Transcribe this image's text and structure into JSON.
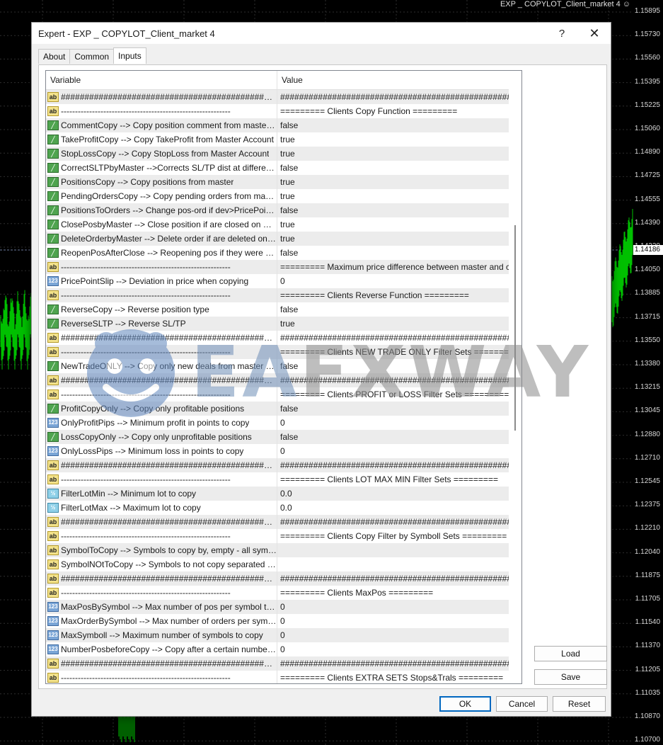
{
  "chart": {
    "title": "EXP _ COPYLOT_Client_market 4 ☺",
    "price_ticks": [
      "1.15895",
      "1.15730",
      "1.15560",
      "1.15395",
      "1.15225",
      "1.15060",
      "1.14890",
      "1.14725",
      "1.14555",
      "1.14390",
      "1.14220",
      "1.14050",
      "1.13885",
      "1.13715",
      "1.13550",
      "1.13380",
      "1.13215",
      "1.13045",
      "1.12880",
      "1.12710",
      "1.12545",
      "1.12375",
      "1.12210",
      "1.12040",
      "1.11875",
      "1.11705",
      "1.11540",
      "1.11370",
      "1.11205",
      "1.11035",
      "1.10870",
      "1.10700"
    ],
    "current_price": "1.14186",
    "candle_color": "#00c000"
  },
  "dialog": {
    "title": "Expert - EXP _ COPYLOT_Client_market 4",
    "help_label": "?",
    "close_label": "✕",
    "tabs": [
      {
        "label": "About",
        "active": false
      },
      {
        "label": "Common",
        "active": false
      },
      {
        "label": "Inputs",
        "active": true
      }
    ],
    "columns": {
      "variable": "Variable",
      "value": "Value"
    },
    "rows": [
      {
        "type": "ab",
        "variable": "###################################################",
        "value": "###################################################"
      },
      {
        "type": "ab",
        "variable": "------------------------------------------------------------",
        "value": "=========  Clients Copy Function  ========="
      },
      {
        "type": "bool",
        "variable": "CommentCopy --> Copy position comment from master position",
        "value": "false"
      },
      {
        "type": "bool",
        "variable": "TakeProfitCopy --> Copy TakeProfit from Master Account",
        "value": "true"
      },
      {
        "type": "bool",
        "variable": "StopLossCopy --> Copy StopLoss from Master Account",
        "value": "true"
      },
      {
        "type": "bool",
        "variable": "CorrectSLTPbyMaster -->Corrects SL/TP dist at different prices",
        "value": "false"
      },
      {
        "type": "bool",
        "variable": "PositionsCopy --> Copy positions from master",
        "value": "true"
      },
      {
        "type": "bool",
        "variable": "PendingOrdersCopy --> Copy pending orders from master",
        "value": "true"
      },
      {
        "type": "bool",
        "variable": "PositionsToOrders --> Change pos-ord if dev>PricePointSlip",
        "value": "false"
      },
      {
        "type": "bool",
        "variable": "ClosePosbyMaster --> Close position if are closed on master",
        "value": "true"
      },
      {
        "type": "bool",
        "variable": "DeleteOrderbyMaster --> Delete order if are deleted on master",
        "value": "true"
      },
      {
        "type": "bool",
        "variable": "ReopenPosAfterClose --> Reopening pos if they were closed",
        "value": "false"
      },
      {
        "type": "ab",
        "variable": "------------------------------------------------------------",
        "value": "=========  Maximum price difference between master and client..."
      },
      {
        "type": "int",
        "variable": "PricePointSlip --> Deviation in price when copying",
        "value": "0"
      },
      {
        "type": "ab",
        "variable": "------------------------------------------------------------",
        "value": "=========  Clients Reverse Function  ========="
      },
      {
        "type": "bool",
        "variable": "ReverseCopy --> Reverse position type",
        "value": "false"
      },
      {
        "type": "bool",
        "variable": "ReverseSLTP --> Reverse SL/TP",
        "value": "true"
      },
      {
        "type": "ab",
        "variable": "###################################################",
        "value": "###################################################"
      },
      {
        "type": "ab",
        "variable": "------------------------------------------------------------",
        "value": "=========  Clients NEW TRADE ONLY  Filter Sets  ========="
      },
      {
        "type": "bool",
        "variable": "NewTradeONLY --> Copy only new deals from master after start",
        "value": "false"
      },
      {
        "type": "ab",
        "variable": "###################################################",
        "value": "###################################################"
      },
      {
        "type": "ab",
        "variable": "------------------------------------------------------------",
        "value": "=========  Clients PROFIT or LOSS  Filter Sets  ========="
      },
      {
        "type": "bool",
        "variable": "ProfitCopyOnly --> Copy only profitable positions",
        "value": "false"
      },
      {
        "type": "int",
        "variable": "OnlyProfitPips --> Minimum profit in points to copy",
        "value": "0"
      },
      {
        "type": "bool",
        "variable": "LossCopyOnly --> Copy only unprofitable positions",
        "value": "false"
      },
      {
        "type": "int",
        "variable": "OnlyLossPips --> Minimum loss in points to copy",
        "value": "0"
      },
      {
        "type": "ab",
        "variable": "###################################################",
        "value": "###################################################"
      },
      {
        "type": "ab",
        "variable": "------------------------------------------------------------",
        "value": "=========  Clients LOT MAX MIN  Filter Sets  ========="
      },
      {
        "type": "dbl",
        "variable": "FilterLotMin --> Minimum lot to copy",
        "value": "0.0"
      },
      {
        "type": "dbl",
        "variable": "FilterLotMax --> Maximum lot to copy",
        "value": "0.0"
      },
      {
        "type": "ab",
        "variable": "###################################################",
        "value": "###################################################"
      },
      {
        "type": "ab",
        "variable": "------------------------------------------------------------",
        "value": "=========  Clients Copy Filter by Symboll Sets  ========="
      },
      {
        "type": "ab",
        "variable": "SymbolToCopy --> Symbols to copy by, empty - all symbols",
        "value": ""
      },
      {
        "type": "ab",
        "variable": "SymbolNOtToCopy --> Symbols to not copy separated by co...",
        "value": ""
      },
      {
        "type": "ab",
        "variable": "###################################################",
        "value": "###################################################"
      },
      {
        "type": "ab",
        "variable": "------------------------------------------------------------",
        "value": "=========  Clients MaxPos   ========="
      },
      {
        "type": "int",
        "variable": "MaxPosBySymbol --> Max number of pos per symbol to copy",
        "value": "0"
      },
      {
        "type": "int",
        "variable": "MaxOrderBySymbol --> Max number of orders per symbol to c...",
        "value": "0"
      },
      {
        "type": "int",
        "variable": "MaxSymboll --> Maximum number of symbols to copy",
        "value": "0"
      },
      {
        "type": "int",
        "variable": "NumberPosbeforeCopy --> Copy after a certain number of pos",
        "value": "0"
      },
      {
        "type": "ab",
        "variable": "###################################################",
        "value": "###################################################"
      },
      {
        "type": "ab",
        "variable": "------------------------------------------------------------",
        "value": "=========  Clients EXTRA SETS Stops&Trals  ========="
      }
    ],
    "icons": {
      "ab": "ab",
      "bool": "╱",
      "int": "123",
      "dbl": "½"
    },
    "buttons": {
      "load": "Load",
      "save": "Save",
      "ok": "OK",
      "cancel": "Cancel",
      "reset": "Reset"
    }
  },
  "watermark": {
    "text_a": "EA",
    "text_b": "FXWAY"
  }
}
